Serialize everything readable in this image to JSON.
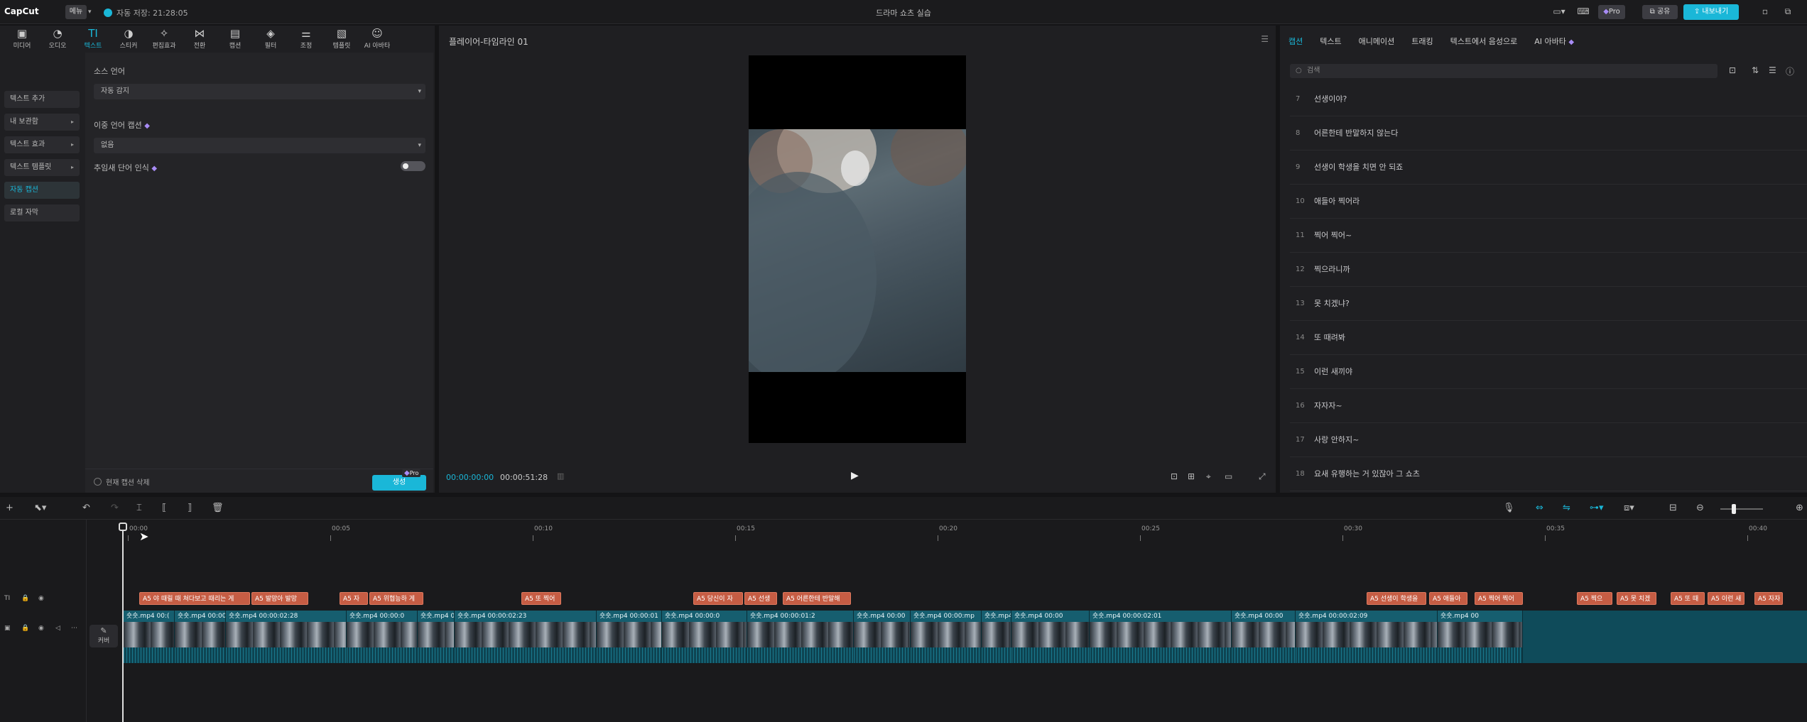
{
  "titlebar": {
    "logo": "CapCut",
    "menu": "메뉴",
    "autosave": "자동 저장: 21:28:05",
    "title": "드라마 쇼츠 실습",
    "pro": "Pro",
    "share": "공유",
    "export": "내보내기"
  },
  "tools": [
    {
      "label": "미디어",
      "icon": "▣"
    },
    {
      "label": "오디오",
      "icon": "◔"
    },
    {
      "label": "텍스트",
      "icon": "TI"
    },
    {
      "label": "스티커",
      "icon": "◑"
    },
    {
      "label": "편집효과",
      "icon": "✧"
    },
    {
      "label": "전환",
      "icon": "⋈"
    },
    {
      "label": "캡션",
      "icon": "▤"
    },
    {
      "label": "필터",
      "icon": "◈"
    },
    {
      "label": "조정",
      "icon": "⚌"
    },
    {
      "label": "템플릿",
      "icon": "▧"
    },
    {
      "label": "AI 아바타",
      "icon": "☺"
    }
  ],
  "subnav": {
    "items": [
      {
        "label": "텍스트 추가",
        "arrow": ""
      },
      {
        "label": "내 보관함",
        "arrow": "▸"
      },
      {
        "label": "텍스트 효과",
        "arrow": "▸"
      },
      {
        "label": "텍스트 템플릿",
        "arrow": "▸"
      },
      {
        "label": "자동 캡션",
        "arrow": ""
      },
      {
        "label": "로컬 자막",
        "arrow": ""
      }
    ]
  },
  "options": {
    "source_label": "소스 언어",
    "source_value": "자동 감지",
    "bilingual_label": "이중 언어 캡션",
    "bilingual_value": "없음",
    "filler_label": "추임새 단어 인식",
    "clear_label": "현재 캡션 삭제",
    "generate": "생성",
    "generate_pro": "Pro"
  },
  "player": {
    "title": "플레이어-타임라인 01",
    "time_current": "00:00:00:00",
    "time_total": "00:00:51:28"
  },
  "right_panel": {
    "tabs": [
      "캡션",
      "텍스트",
      "애니메이션",
      "트래킹",
      "텍스트에서 음성으로",
      "AI 아바타"
    ],
    "search_placeholder": "검색",
    "captions": [
      {
        "num": "7",
        "text": "선생이야?"
      },
      {
        "num": "8",
        "text": "어른한테 반말하지 않는다"
      },
      {
        "num": "9",
        "text": "선생이 학생을 치면 안 되죠"
      },
      {
        "num": "10",
        "text": "애들아 찍어라"
      },
      {
        "num": "11",
        "text": "찍어 찍어~"
      },
      {
        "num": "12",
        "text": "찍으라니까"
      },
      {
        "num": "13",
        "text": "못 치겠냐?"
      },
      {
        "num": "14",
        "text": "또 때려봐"
      },
      {
        "num": "15",
        "text": "이런 새끼야"
      },
      {
        "num": "16",
        "text": "자자자~"
      },
      {
        "num": "17",
        "text": "사랑 안하지~"
      },
      {
        "num": "18",
        "text": "요새 유행하는 거 있잖아 그 쇼츠"
      }
    ]
  },
  "timeline": {
    "ticks": [
      "00:00",
      "00:05",
      "00:10",
      "00:15",
      "00:20",
      "00:25",
      "00:30",
      "00:35",
      "00:40"
    ],
    "cover": "커버",
    "text_clips": [
      "A5 야 때릴 때 쳐다보고 때리는 게",
      "A5 발망아 발망",
      "A5 자",
      "A5 위협능하 게",
      "A5 또 찍어",
      "A5 당신이 자",
      "A5 선생",
      "A5 어른한테 반말해",
      "A5 선생이 학생을",
      "A5 애들아",
      "A5 찍어 찍어",
      "A5 찍으",
      "A5 못 치겠",
      "A5 또 때",
      "A5 이런 새",
      "A5 자자"
    ],
    "video_clips": [
      {
        "name": "숏숏.mp4  00:("
      },
      {
        "name": "숏숏.mp4  00:00:0"
      },
      {
        "name": "숏숏.mp4  00:00:02:28"
      },
      {
        "name": "숏숏.mp4  00:00:0"
      },
      {
        "name": "숏숏.mp4  0"
      },
      {
        "name": "숏숏.mp4  00:00:02:23"
      },
      {
        "name": "숏숏.mp4  00:00:01"
      },
      {
        "name": "숏숏.mp4  00:00:0"
      },
      {
        "name": "숏숏.mp4  00:00:01:2"
      },
      {
        "name": "숏숏.mp4  00:00"
      },
      {
        "name": "숏숏.mp4  00:00:mp"
      },
      {
        "name": "숏숏.mp4  0"
      },
      {
        "name": "숏숏.mp4  00:00"
      },
      {
        "name": "숏숏.mp4  00:00:02:01"
      },
      {
        "name": "숏숏.mp4  00:00"
      },
      {
        "name": "숏숏.mp4  00:00:02:09"
      },
      {
        "name": "숏숏.mp4  00"
      }
    ]
  },
  "colors": {
    "accent": "#1ab7d8",
    "text_clip": "#c65d44",
    "video_track": "#0f4b5a"
  }
}
